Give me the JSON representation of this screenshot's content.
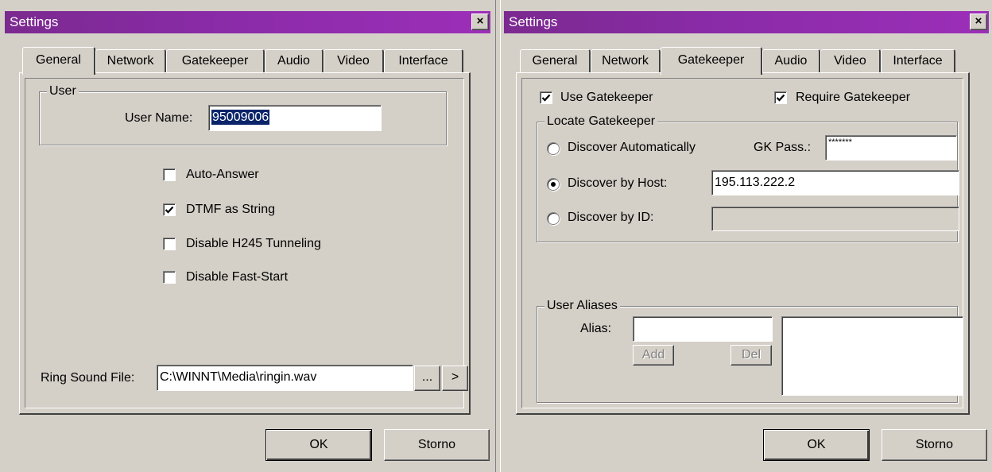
{
  "left": {
    "title": "Settings",
    "close_glyph": "×",
    "tabs": [
      "General",
      "Network",
      "Gatekeeper",
      "Audio",
      "Video",
      "Interface"
    ],
    "active_tab": "General",
    "user_group": {
      "label": "User",
      "user_name_label": "User Name:",
      "user_name_value": "95009006"
    },
    "checkboxes": [
      {
        "label": "Auto-Answer",
        "checked": false
      },
      {
        "label": "DTMF as String",
        "checked": true
      },
      {
        "label": "Disable H245 Tunneling",
        "checked": false
      },
      {
        "label": "Disable Fast-Start",
        "checked": false
      }
    ],
    "ring_sound_label": "Ring Sound File:",
    "ring_sound_value": "C:\\WINNT\\Media\\ringin.wav",
    "browse_label": "...",
    "play_label": ">",
    "ok_label": "OK",
    "cancel_label": "Storno"
  },
  "right": {
    "title": "Settings",
    "close_glyph": "×",
    "tabs": [
      "General",
      "Network",
      "Gatekeeper",
      "Audio",
      "Video",
      "Interface"
    ],
    "active_tab": "Gatekeeper",
    "use_gatekeeper": {
      "label": "Use Gatekeeper",
      "checked": true
    },
    "require_gatekeeper": {
      "label": "Require Gatekeeper",
      "checked": true
    },
    "locate_group": {
      "label": "Locate Gatekeeper",
      "discover_auto_label": "Discover Automatically",
      "gk_pass_label": "GK Pass.:",
      "gk_pass_value": "*******",
      "discover_host_label": "Discover by Host:",
      "host_value": "195.113.222.2",
      "discover_id_label": "Discover by ID:",
      "id_value": "",
      "selected": "Discover by Host"
    },
    "aliases_group": {
      "label": "User Aliases",
      "alias_label": "Alias:",
      "alias_value": "",
      "add_label": "Add",
      "del_label": "Del"
    },
    "ok_label": "OK",
    "cancel_label": "Storno"
  }
}
